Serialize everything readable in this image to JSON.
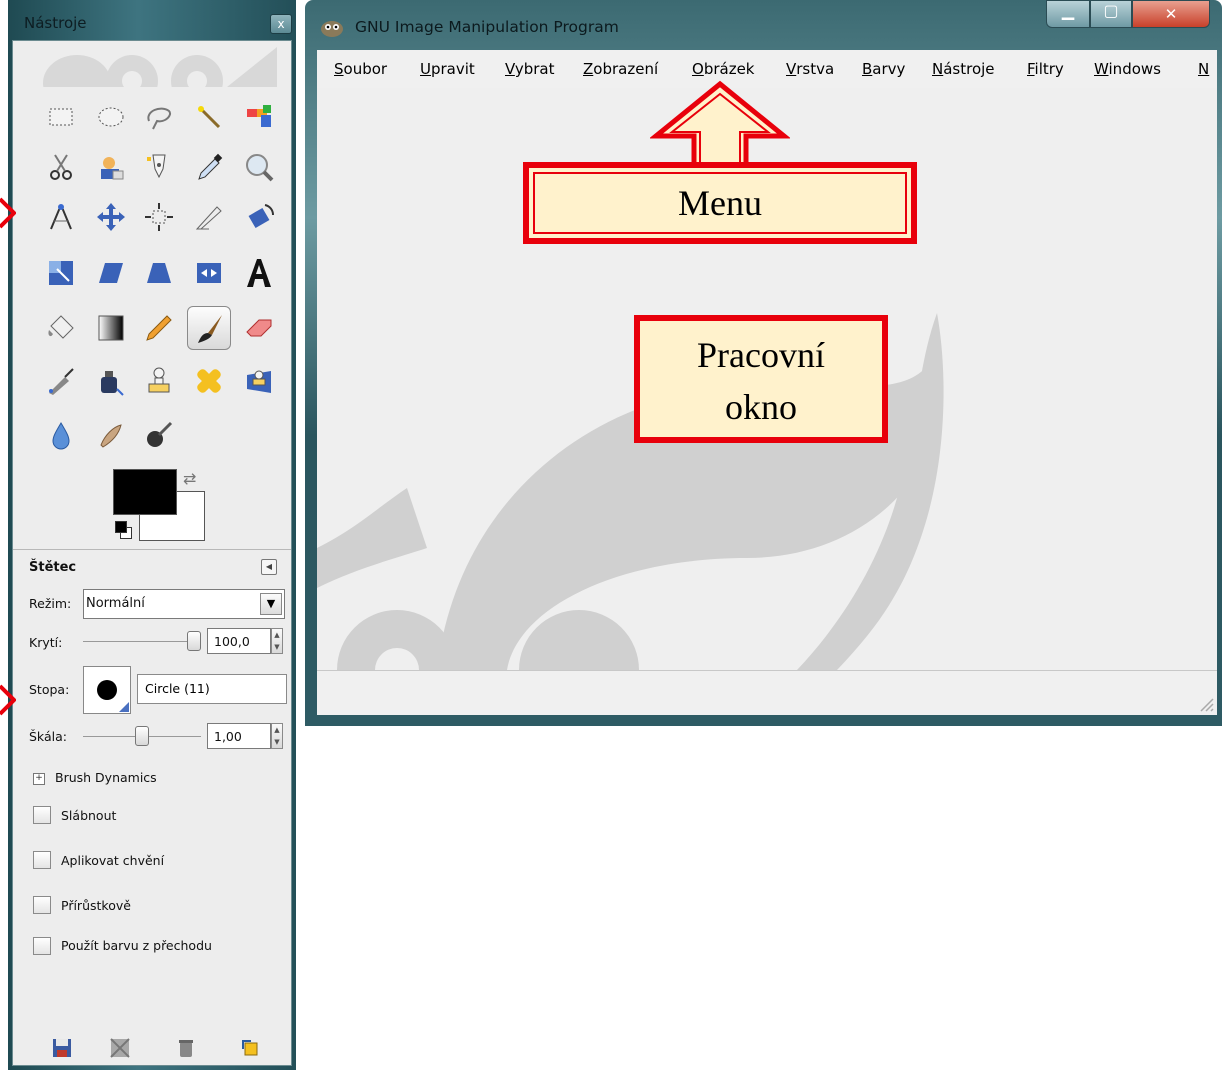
{
  "toolbox": {
    "title": "Nástroje",
    "close_label": "x",
    "tool_options": {
      "title": "Štětec",
      "mode_label": "Režim:",
      "mode_value": "Normální",
      "opacity_label": "Krytí:",
      "opacity_value": "100,0",
      "opacity_fraction": 1.0,
      "brush_label": "Stopa:",
      "brush_name": "Circle (11)",
      "scale_label": "Škála:",
      "scale_value": "1,00",
      "scale_fraction": 0.5,
      "dynamics_label": "Brush Dynamics",
      "checkboxes": [
        {
          "label": "Slábnout",
          "checked": false
        },
        {
          "label": "Aplikovat chvění",
          "checked": false
        },
        {
          "label": "Přírůstkově",
          "checked": false
        },
        {
          "label": "Použít barvu z přechodu",
          "checked": false
        }
      ]
    },
    "foreground_color": "#000000",
    "background_color": "#ffffff"
  },
  "main_window": {
    "title": "GNU Image Manipulation Program",
    "menu": [
      "Soubor",
      "Upravit",
      "Vybrat",
      "Zobrazení",
      "Obrázek",
      "Vrstva",
      "Barvy",
      "Nástroje",
      "Filtry",
      "Windows",
      "N"
    ]
  },
  "annotations": {
    "menu_label": "Menu",
    "work_label_line1": "Pracovní",
    "work_label_line2": "okno"
  },
  "colors": {
    "annotation_red": "#e8000b",
    "annotation_fill": "#fff2cc",
    "window_frame": "#3c6a72"
  }
}
